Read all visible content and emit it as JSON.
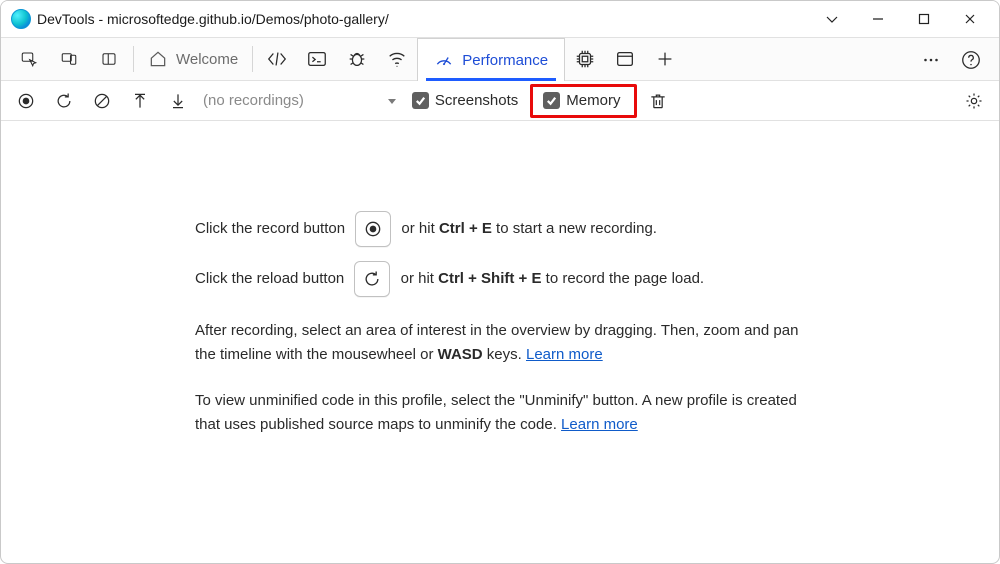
{
  "window": {
    "title": "DevTools - microsoftedge.github.io/Demos/photo-gallery/"
  },
  "tabs": {
    "welcome_label": "Welcome",
    "performance_label": "Performance"
  },
  "perfbar": {
    "no_recordings": "(no recordings)",
    "screenshots_label": "Screenshots",
    "memory_label": "Memory"
  },
  "content": {
    "record_pre": "Click the record button",
    "record_post_1": "or hit ",
    "record_shortcut": "Ctrl + E",
    "record_post_2": " to start a new recording.",
    "reload_pre": "Click the reload button",
    "reload_post_1": "or hit ",
    "reload_shortcut": "Ctrl + Shift + E",
    "reload_post_2": " to record the page load.",
    "overview_1": "After recording, select an area of interest in the overview by dragging. Then, zoom and pan the timeline with the mousewheel or ",
    "overview_wasd": "WASD",
    "overview_2": " keys. ",
    "learn_more": "Learn more",
    "unminify_1": "To view unminified code in this profile, select the \"Unminify\" button. A new profile is created that uses published source maps to unminify the code. ",
    "learn_more_2": "Learn more"
  }
}
